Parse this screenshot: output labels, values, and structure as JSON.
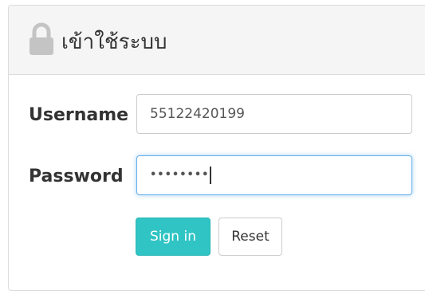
{
  "panel": {
    "title": "เข้าใช้ระบบ",
    "icon": "lock-icon"
  },
  "form": {
    "username_label": "Username",
    "username_value": "55122420199",
    "password_label": "Password",
    "password_value": "••••••••",
    "signin_label": "Sign in",
    "reset_label": "Reset"
  },
  "colors": {
    "primary_button": "#31c4c4",
    "focus_border": "#66afe9",
    "heading_background": "#f5f5f5"
  }
}
